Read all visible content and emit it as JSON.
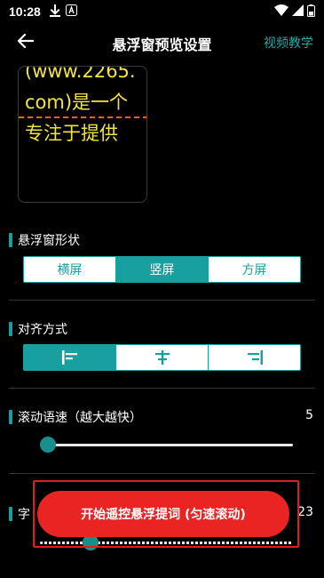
{
  "status_bar": {
    "time": "10:28",
    "icons": [
      "download-icon",
      "a-icon",
      "wifi-icon",
      "signal-icon",
      "battery-icon"
    ]
  },
  "app_bar": {
    "title": "悬浮窗预览设置",
    "tutorial_link": "视频教学",
    "back_icon": "arrow-left-icon"
  },
  "preview": {
    "text": "(www.2265.com)是一个专注于提供"
  },
  "shape_section": {
    "label": "悬浮窗形状",
    "options": [
      "横屏",
      "竖屏",
      "方屏"
    ],
    "selected": "竖屏"
  },
  "align_section": {
    "label": "对齐方式",
    "options": [
      "align-left-icon",
      "align-center-icon",
      "align-right-icon"
    ],
    "selected": "align-left-icon"
  },
  "speed_section": {
    "label": "滚动语速（越大越快）",
    "value": "5",
    "level": 0.03
  },
  "font_section": {
    "label": "字",
    "value": "23",
    "level": 0.2
  },
  "start_button": {
    "label": "开始遥控悬浮提词 (匀速滚动)"
  },
  "colors": {
    "accent": "#18a0a0",
    "cta": "#ea2323",
    "preview_text": "#f4e53a",
    "guide_line": "#ff5a1f"
  }
}
